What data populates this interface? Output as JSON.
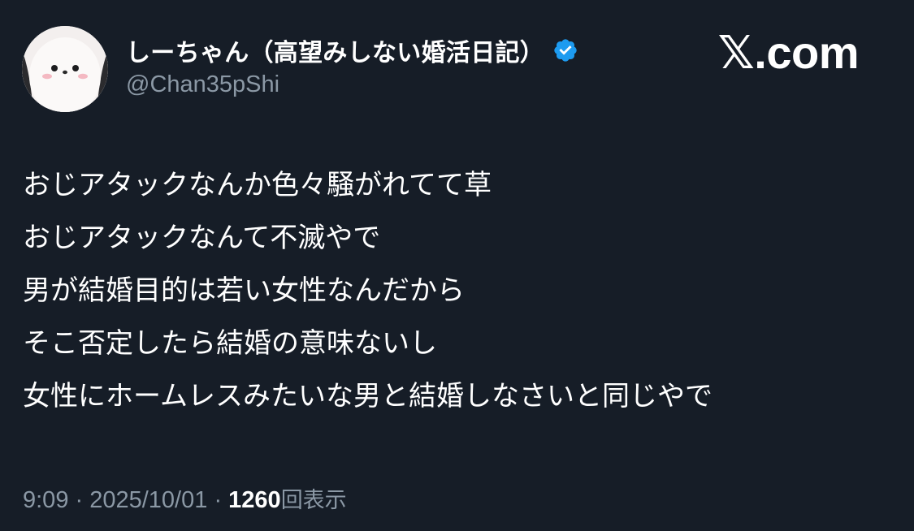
{
  "header": {
    "display_name": "しーちゃん（高望みしない婚活日記）",
    "handle": "@Chan35pShi",
    "brand": "𝕏.com",
    "avatar_icon": "snow-bird-avatar-icon",
    "verified_icon": "verified-badge-icon"
  },
  "post": {
    "lines": [
      "おじアタックなんか色々騒がれてて草",
      "おじアタックなんて不滅やで",
      "男が結婚目的は若い女性なんだから",
      "そこ否定したら結婚の意味ないし",
      "女性にホームレスみたいな男と結婚しなさいと同じやで"
    ]
  },
  "meta": {
    "time": "9:09",
    "separator_1": " · ",
    "date": "2025/10/01",
    "separator_2": " · ",
    "views_count": "1260",
    "views_label": "回表示"
  },
  "colors": {
    "background": "#161d27",
    "text": "#ffffff",
    "muted": "#8b98a5",
    "verified": "#1d9bf0"
  }
}
